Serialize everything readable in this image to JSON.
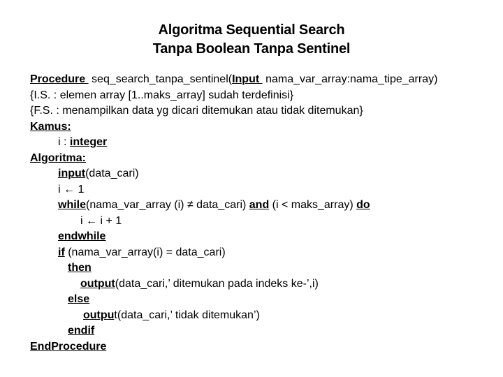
{
  "title": {
    "line1": "Algoritma Sequential Search",
    "line2": "Tanpa Boolean Tanpa Sentinel"
  },
  "code": {
    "procedure_kw": "Procedure ",
    "procedure_name": " seq_search_tanpa_sentinel(",
    "input_kw": "Input ",
    "procedure_params": " nama_var_array:nama_tipe_array)",
    "is_comment": "{I.S. : elemen array [1..maks_array] sudah terdefinisi}",
    "fs_comment": "{F.S. : menampilkan data yg dicari ditemukan atau tidak ditemukan}",
    "kamus_kw": "Kamus:",
    "var_decl": "i : ",
    "integer_kw": "integer",
    "algoritma_kw": "Algoritma:",
    "input_call_kw": "input",
    "input_call_args": "(data_cari)",
    "assign_init": "i ⇐ 1",
    "assign_init_text": "i ← 1",
    "while_kw": "while",
    "while_cond": "(nama_var_array (i) ≠ data_cari) ",
    "and_kw": "and",
    "while_cond2": " (i < maks_array) ",
    "do_kw": "do",
    "increment": "i ← i + 1",
    "endwhile_kw": "endwhile",
    "if_kw": "if",
    "if_cond": " (nama_var_array(i) = data_cari)",
    "then_kw": "then",
    "output_kw": "output",
    "output_args_found": "(data_cari,’ ditemukan pada indeks ke-’,i)",
    "else_kw": "else",
    "output_kw_partial": "outpu",
    "output_kw_tail": "t",
    "output_args_notfound": "(data_cari,’ tidak ditemukan’)",
    "endif_kw": "endif",
    "endprocedure_kw": "EndProcedure"
  }
}
